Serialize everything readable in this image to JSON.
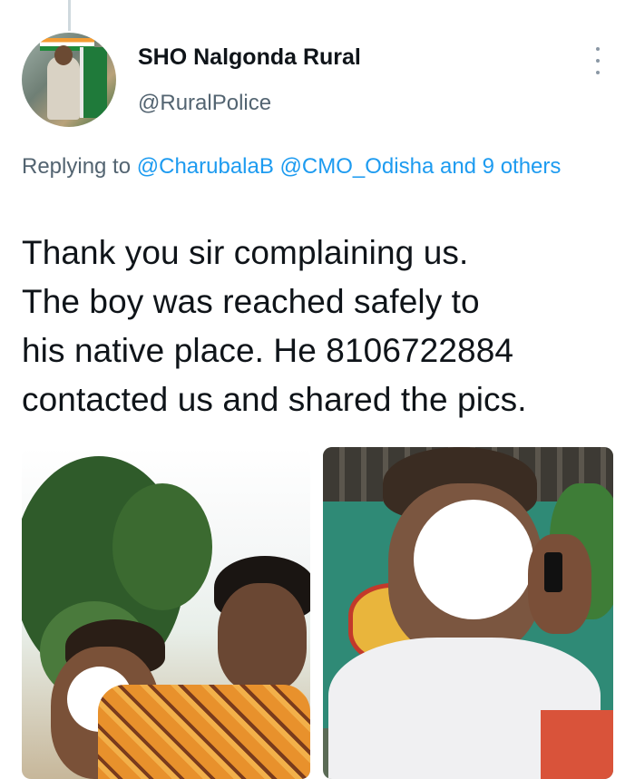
{
  "tweet": {
    "author_name": "SHO Nalgonda Rural",
    "author_handle": "@RuralPolice",
    "reply": {
      "prefix": "Replying to ",
      "mention_1": "@CharubalaB",
      "mention_2": "@CMO_Odisha",
      "others": "and 9 others"
    },
    "text_lines": [
      "Thank you sir complaining us.",
      "The boy was reached safely to",
      "his native place. He 8106722884",
      "contacted us and shared the pics."
    ]
  },
  "icons": {
    "more": "more-vertical-icon"
  },
  "colors": {
    "link": "#1d9bf0",
    "secondary_text": "#536471",
    "primary_text": "#0f1419"
  }
}
